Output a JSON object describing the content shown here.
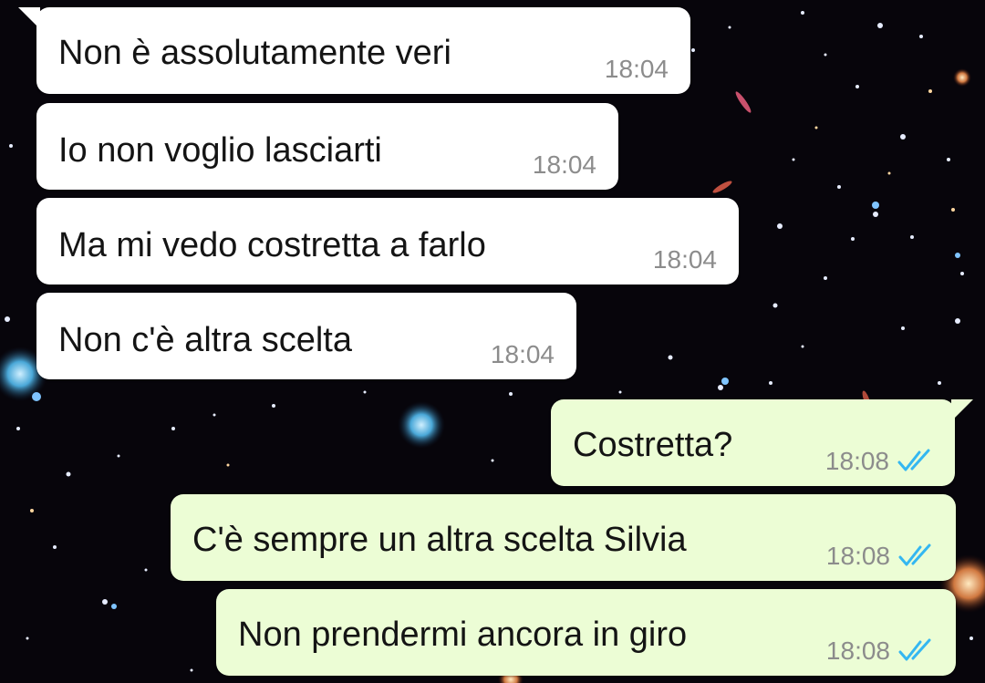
{
  "colors": {
    "incoming_bubble": "#ffffff",
    "outgoing_bubble": "#ecfdd5",
    "text": "#141414",
    "timestamp": "#8c8c8c",
    "read_ticks": "#34b7f1"
  },
  "icons": {
    "read_receipt": "double-check-icon"
  },
  "messages": [
    {
      "direction": "incoming",
      "text": "Non è assolutamente veri",
      "time": "18:04"
    },
    {
      "direction": "incoming",
      "text": "Io non voglio lasciarti",
      "time": "18:04"
    },
    {
      "direction": "incoming",
      "text": "Ma mi vedo costretta a farlo",
      "time": "18:04"
    },
    {
      "direction": "incoming",
      "text": "Non c'è altra scelta",
      "time": "18:04"
    },
    {
      "direction": "outgoing",
      "text": "Costretta?",
      "time": "18:08",
      "status": "read"
    },
    {
      "direction": "outgoing",
      "text": "C'è sempre un altra scelta Silvia",
      "time": "18:08",
      "status": "read"
    },
    {
      "direction": "outgoing",
      "text": "Non prendermi ancora in giro",
      "time": "18:08",
      "status": "read"
    }
  ]
}
